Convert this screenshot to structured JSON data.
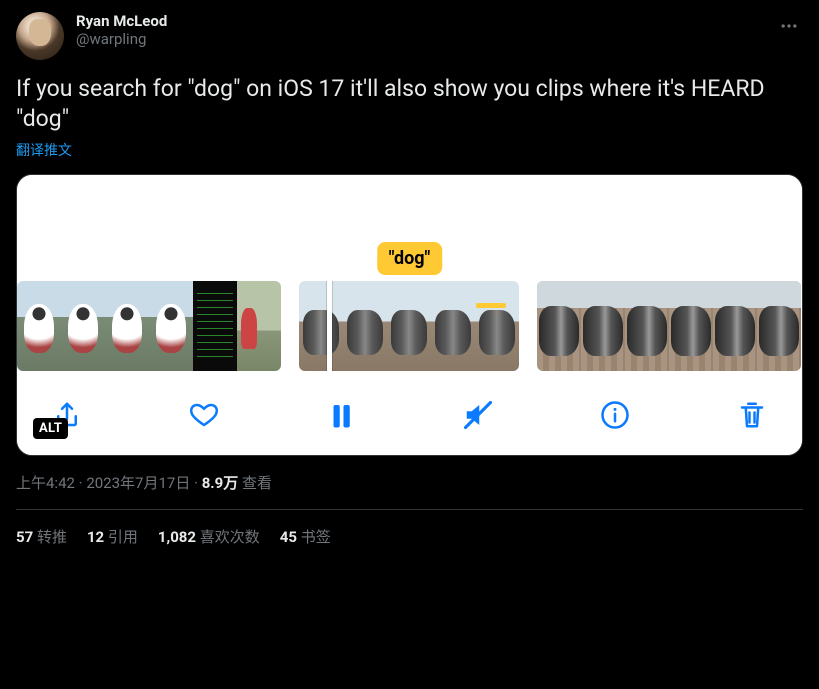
{
  "author": {
    "display_name": "Ryan McLeod",
    "handle": "@warpling"
  },
  "tweet_text": "If you search for \"dog\" on iOS 17 it'll also show you clips where it's HEARD \"dog\"",
  "translate_label": "翻译推文",
  "media": {
    "search_bubble": "\"dog\"",
    "alt_badge": "ALT"
  },
  "meta": {
    "time": "上午4:42",
    "dot1": " · ",
    "date": "2023年7月17日",
    "dot2": " · ",
    "views_count": "8.9万",
    "views_label": " 查看"
  },
  "stats": {
    "retweets_n": "57",
    "retweets_label": " 转推",
    "quotes_n": "12",
    "quotes_label": " 引用",
    "likes_n": "1,082",
    "likes_label": " 喜欢次数",
    "bookmarks_n": "45",
    "bookmarks_label": " 书签"
  }
}
